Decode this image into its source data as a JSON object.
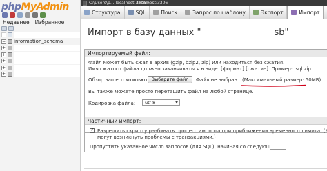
{
  "sidebar": {
    "logo_part1": "php",
    "logo_part2": "MyAdmin",
    "tabs": [
      "Недавнее",
      "Избранное"
    ],
    "databases": [
      {
        "name": "information_schema",
        "expander": "−"
      },
      {
        "name": "",
        "expander": "+"
      },
      {
        "name": "",
        "expander": "+"
      },
      {
        "name": "",
        "expander": "+"
      },
      {
        "name": "",
        "expander": "+"
      },
      {
        "name": "",
        "expander": "+"
      }
    ]
  },
  "breadcrumb": {
    "part1": "C:\\Users\\p... localhost:3306 »",
    "part2": "localhost:3306"
  },
  "tabs": [
    {
      "label": "Структура",
      "icon": "structure-icon",
      "color": "#8aa3c8"
    },
    {
      "label": "SQL",
      "icon": "sql-icon",
      "color": "#7a8fb0"
    },
    {
      "label": "Поиск",
      "icon": "search-icon",
      "color": "#a0a0a0"
    },
    {
      "label": "Запрос по шаблону",
      "icon": "query-icon",
      "color": "#a0a0a0"
    },
    {
      "label": "Экспорт",
      "icon": "export-icon",
      "color": "#7fa36a"
    },
    {
      "label": "Импорт",
      "icon": "import-icon",
      "color": "#8d6fb3",
      "active": true
    }
  ],
  "page": {
    "title_prefix": "Импорт в базу данных \"",
    "title_suffix": "\"",
    "title_tail": "sb\""
  },
  "file_section": {
    "legend": "Импортируемый файл:",
    "line1": "Файл может быть сжат в архив (gzip, bzip2, zip) или находиться без сжатия.",
    "line2": "Имя сжатого файла должно заканчиваться в виде .[формат].[сжатие]. Пример: .sql.zip",
    "browse_label": "Обзор вашего компьютера:",
    "browse_button": "Выберите файл",
    "no_file": "Файл не выбран",
    "max_size": "(Максимальный размер: 50MB)",
    "drag_hint": "Вы также можете просто перетащить файл на любой странице.",
    "encoding_label": "Кодировка файла:",
    "encoding_value": "utf-8"
  },
  "partial_section": {
    "legend": "Частичный импорт:",
    "allow_interrupt": "Разрешить скрипту разбивать процесс импорта при приближении временного лимита. (Может быть",
    "allow_interrupt_2": "могут возникнуть проблемы с транзакциями.)",
    "skip_label": "Пропустить указанное число запросов (для SQL), начиная со следующего:",
    "skip_value": ""
  },
  "colors": {
    "accent_red": "#d0021b",
    "tab_bar": "#e4e4e4",
    "sidebar_bg": "#f3f3f3"
  }
}
